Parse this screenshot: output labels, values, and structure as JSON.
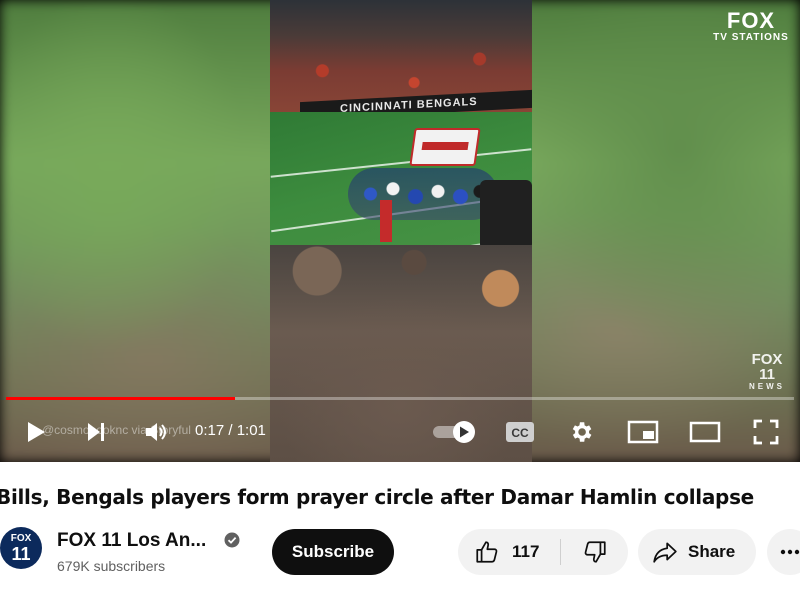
{
  "player": {
    "brand_watermark_top": {
      "line1": "FOX",
      "line2": "TV STATIONS"
    },
    "brand_watermark_bottom": {
      "line1": "FOX 11",
      "line2": "NEWS"
    },
    "stadium_banner_text": "CINCINNATI BENGALS",
    "overlay_credit": "@cosmobooknc via Storyful",
    "time_current": "0:17",
    "time_total": "1:01",
    "time_display": "0:17 / 1:01",
    "progress_played_fraction": 0.29,
    "accent_color": "#ff0000",
    "controls": {
      "play_icon": "play-icon",
      "next_icon": "next-icon",
      "volume_icon": "volume-icon",
      "autoplay_icon": "autoplay-toggle-icon",
      "captions_label": "CC",
      "settings_icon": "gear-icon",
      "miniplayer_icon": "miniplayer-icon",
      "theater_icon": "theater-mode-icon",
      "fullscreen_icon": "fullscreen-icon"
    }
  },
  "video": {
    "title": "Bills, Bengals players form prayer circle after Damar Hamlin collapse"
  },
  "channel": {
    "avatar": {
      "line1": "FOX",
      "line2": "11"
    },
    "name": "FOX 11 Los An...",
    "verified_icon": "verified-check-icon",
    "subscribers": "679K subscribers",
    "subscribe_label": "Subscribe"
  },
  "actions": {
    "like_icon": "thumbs-up-icon",
    "like_count": "117",
    "dislike_icon": "thumbs-down-icon",
    "share_icon": "share-arrow-icon",
    "share_label": "Share",
    "more_icon": "more-horizontal-icon"
  }
}
